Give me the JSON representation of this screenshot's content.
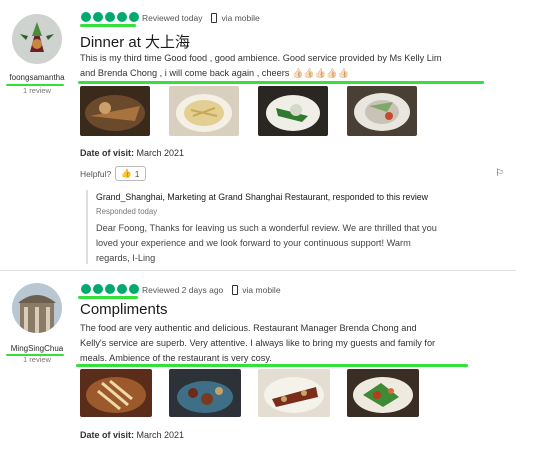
{
  "reviews": [
    {
      "username": "foongsamantha",
      "review_count": "1 review",
      "rating": 5,
      "reviewed": "Reviewed today",
      "via": "via mobile",
      "title": "Dinner at 大上海",
      "body_line1": "This is my third time Good food , good ambience. Good service provided by Ms Kelly Lim",
      "body_line2": "and Brenda Chong , i will come back again , cheers 👍🏻👍🏻👍🏻👍🏻👍🏻",
      "date_label": "Date of visit:",
      "date_value": "March 2021",
      "helpful_label": "Helpful?",
      "helpful_count": "1",
      "response": {
        "header": "Grand_Shanghai, Marketing at Grand Shanghai Restaurant, responded to this review",
        "when": "Responded today",
        "line1": "Dear Foong, Thanks for leaving us such a wonderful review. We are thrilled that you",
        "line2": "loved your experience and we look forward to your continuous support! Warm",
        "line3": "regards, I-Ling"
      }
    },
    {
      "username": "MingSingChua",
      "review_count": "1 review",
      "rating": 5,
      "reviewed": "Reviewed 2 days ago",
      "via": "via mobile",
      "title": "Compliments",
      "body_line1": "The food are very authentic and delicious. Restaurant Manager Brenda Chong and",
      "body_line2": "Kelly's service are superb. Very attentive. I always like to bring my guests and family for",
      "body_line3": "meals. Ambience of the restaurant is very cosy.",
      "date_label": "Date of visit:",
      "date_value": "March 2021"
    }
  ],
  "icons": {
    "flag": "flag-icon",
    "thumb": "thumbs-up-icon",
    "phone": "mobile-phone-icon"
  },
  "colors": {
    "rating": "#00aa6c",
    "highlight": "#34e03c"
  }
}
